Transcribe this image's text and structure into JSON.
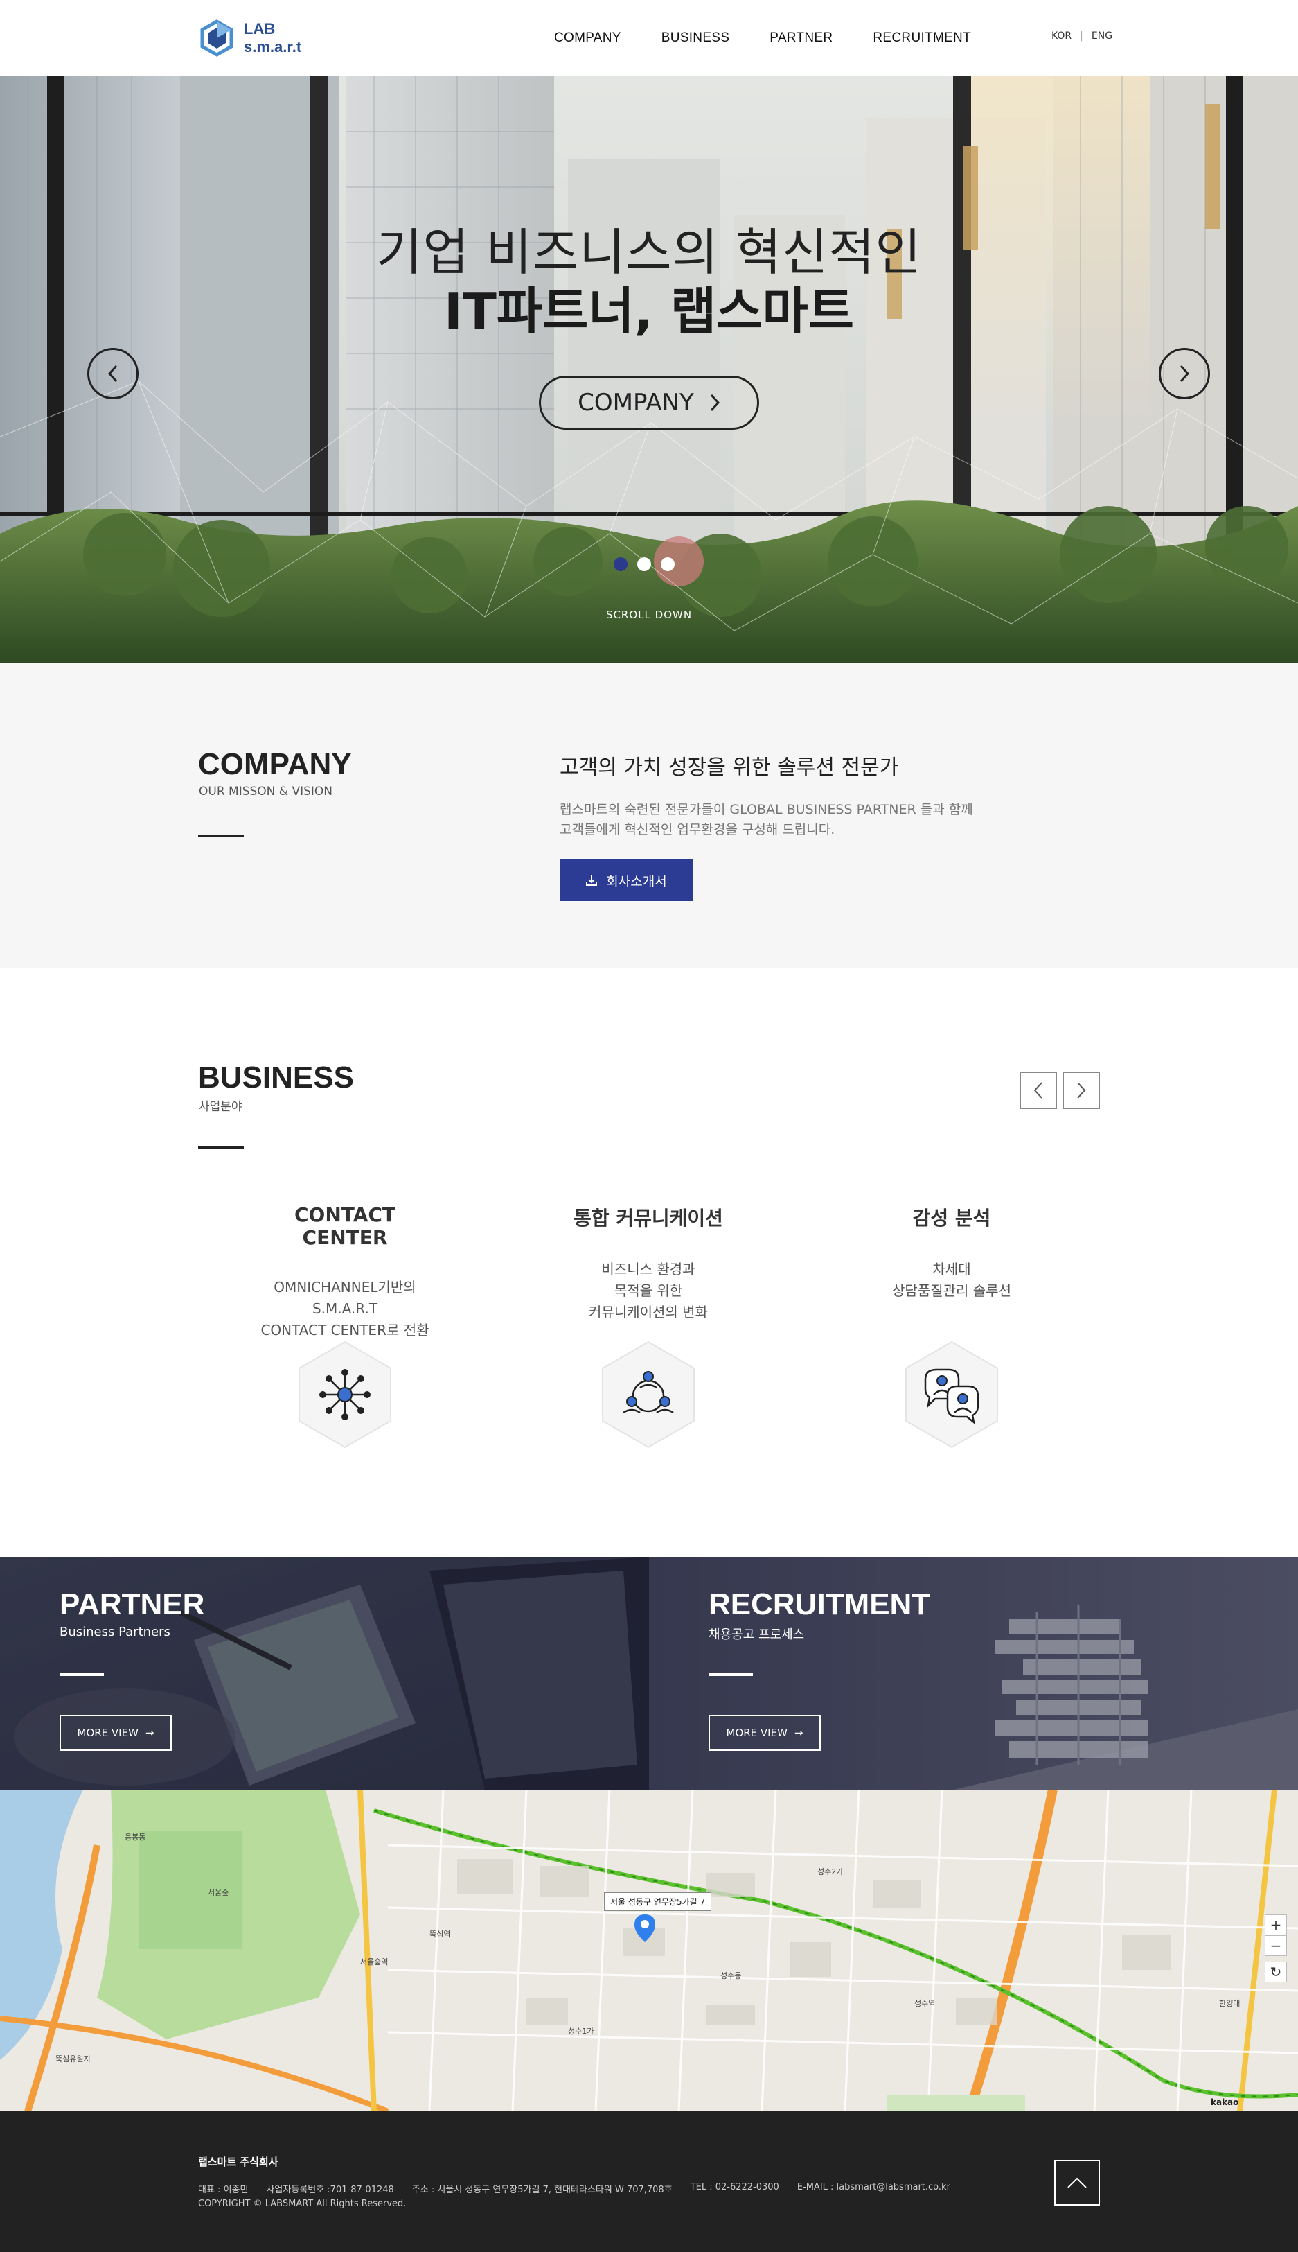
{
  "header": {
    "logo_line1": "LAB",
    "logo_line2": "s.m.a.r.t",
    "nav": [
      "COMPANY",
      "BUSINESS",
      "PARTNER",
      "RECRUITMENT"
    ],
    "lang_kor": "KOR",
    "lang_sep": "|",
    "lang_eng": "ENG"
  },
  "hero": {
    "title_line1": "기업 비즈니스의 혁신적인",
    "title_line2": "IT파트너, 랩스마트",
    "button_label": "COMPANY",
    "slides_count": 3,
    "active_slide": 1,
    "scroll_label": "SCROLL DOWN"
  },
  "company": {
    "title": "COMPANY",
    "subtitle": "OUR MISSON & VISION",
    "heading": "고객의 가치 성장을 위한 솔루션 전문가",
    "desc_line1": "랩스마트의 숙련된 전문가들이 GLOBAL BUSINESS PARTNER 들과 함께",
    "desc_line2": "고객들에게 혁신적인 업무환경을 구성해 드립니다.",
    "download_label": "회사소개서"
  },
  "business": {
    "title": "BUSINESS",
    "subtitle": "사업분야",
    "cards": [
      {
        "title": "CONTACT CENTER",
        "desc": [
          "OMNICHANNEL기반의",
          "S.M.A.R.T",
          "CONTACT CENTER로 전환"
        ],
        "icon": "network-icon"
      },
      {
        "title": "통합 커뮤니케이션",
        "desc": [
          "비즈니스 환경과",
          "목적을 위한",
          "커뮤니케이션의 변화"
        ],
        "icon": "team-icon"
      },
      {
        "title": "감성 분석",
        "desc": [
          "차세대",
          "상담품질관리 솔루션"
        ],
        "icon": "chat-users-icon"
      }
    ]
  },
  "partner": {
    "title": "PARTNER",
    "subtitle": "Business Partners",
    "button_label": "MORE VIEW"
  },
  "recruitment": {
    "title": "RECRUITMENT",
    "subtitle": "채용공고 프로세스",
    "button_label": "MORE VIEW"
  },
  "map": {
    "tooltip": "서울 성동구 연무장5가길 7",
    "labels": [
      "서울숲",
      "성수동",
      "뚝섬역",
      "성수역",
      "서울숲역",
      "응봉동",
      "성수2가",
      "성수1가",
      "한양대",
      "뚝섬유원지"
    ],
    "brand": "kakao"
  },
  "footer": {
    "company_name": "랩스마트 주식회사",
    "ceo": "대표 : 이종민",
    "biz_no": "사업자등록번호 :701-87-01248",
    "address": "주소 : 서울시 성동구 연무장5가길 7, 현대테라스타워 W 707,708호",
    "tel": "TEL : 02-6222-0300",
    "email": "E-MAIL : labsmart@labsmart.co.kr",
    "copyright": "COPYRIGHT © LABSMART All Rights Reserved."
  },
  "colors": {
    "accent": "#2c3b93",
    "footer_bg": "#222222",
    "section_bg": "#f6f6f6",
    "logo": "#2a4e8f"
  }
}
